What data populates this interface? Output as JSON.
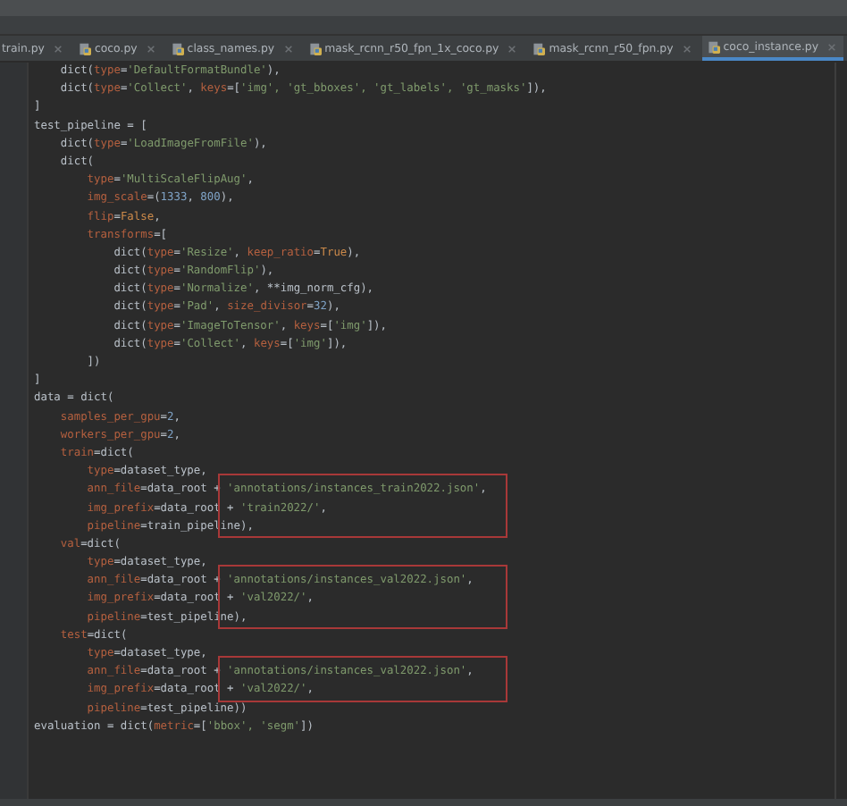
{
  "tabs": [
    {
      "label": "train.py",
      "icon": false,
      "selected": false
    },
    {
      "label": "coco.py",
      "icon": true,
      "selected": false
    },
    {
      "label": "class_names.py",
      "icon": true,
      "selected": false
    },
    {
      "label": "mask_rcnn_r50_fpn_1x_coco.py",
      "icon": true,
      "selected": false
    },
    {
      "label": "mask_rcnn_r50_fpn.py",
      "icon": true,
      "selected": false
    },
    {
      "label": "coco_instance.py",
      "icon": true,
      "selected": true
    }
  ],
  "code_lines": [
    {
      "boxed": false,
      "tokens": [
        {
          "kind": "plain",
          "text": "    dict("
        },
        {
          "kind": "param",
          "text": "type"
        },
        {
          "kind": "plain",
          "text": "="
        },
        {
          "kind": "string",
          "text": "'DefaultFormatBundle'"
        },
        {
          "kind": "plain",
          "text": "),"
        }
      ]
    },
    {
      "boxed": false,
      "tokens": [
        {
          "kind": "plain",
          "text": "    dict("
        },
        {
          "kind": "param",
          "text": "type"
        },
        {
          "kind": "plain",
          "text": "="
        },
        {
          "kind": "string",
          "text": "'Collect'"
        },
        {
          "kind": "plain",
          "text": ", "
        },
        {
          "kind": "param",
          "text": "keys"
        },
        {
          "kind": "plain",
          "text": "=["
        },
        {
          "kind": "string",
          "text": "'img', 'gt_bboxes', 'gt_labels', 'gt_masks'"
        },
        {
          "kind": "plain",
          "text": "]),"
        }
      ]
    },
    {
      "boxed": false,
      "tokens": [
        {
          "kind": "plain",
          "text": "]"
        }
      ]
    },
    {
      "boxed": false,
      "tokens": [
        {
          "kind": "plain",
          "text": "test_pipeline = ["
        }
      ]
    },
    {
      "boxed": false,
      "tokens": [
        {
          "kind": "plain",
          "text": "    dict("
        },
        {
          "kind": "param",
          "text": "type"
        },
        {
          "kind": "plain",
          "text": "="
        },
        {
          "kind": "string",
          "text": "'LoadImageFromFile'"
        },
        {
          "kind": "plain",
          "text": "),"
        }
      ]
    },
    {
      "boxed": false,
      "tokens": [
        {
          "kind": "plain",
          "text": "    dict("
        }
      ]
    },
    {
      "boxed": false,
      "tokens": [
        {
          "kind": "param",
          "text": "        type"
        },
        {
          "kind": "plain",
          "text": "="
        },
        {
          "kind": "string",
          "text": "'MultiScaleFlipAug'"
        },
        {
          "kind": "plain",
          "text": ","
        }
      ]
    },
    {
      "boxed": false,
      "tokens": [
        {
          "kind": "param",
          "text": "        img_scale"
        },
        {
          "kind": "plain",
          "text": "=("
        },
        {
          "kind": "number",
          "text": "1333"
        },
        {
          "kind": "plain",
          "text": ", "
        },
        {
          "kind": "number",
          "text": "800"
        },
        {
          "kind": "plain",
          "text": "),"
        }
      ]
    },
    {
      "boxed": false,
      "tokens": [
        {
          "kind": "param",
          "text": "        flip"
        },
        {
          "kind": "plain",
          "text": "="
        },
        {
          "kind": "keyword",
          "text": "False"
        },
        {
          "kind": "plain",
          "text": ","
        }
      ]
    },
    {
      "boxed": false,
      "tokens": [
        {
          "kind": "param",
          "text": "        transforms"
        },
        {
          "kind": "plain",
          "text": "=["
        }
      ]
    },
    {
      "boxed": false,
      "tokens": [
        {
          "kind": "plain",
          "text": "            dict("
        },
        {
          "kind": "param",
          "text": "type"
        },
        {
          "kind": "plain",
          "text": "="
        },
        {
          "kind": "string",
          "text": "'Resize'"
        },
        {
          "kind": "plain",
          "text": ", "
        },
        {
          "kind": "param",
          "text": "keep_ratio"
        },
        {
          "kind": "plain",
          "text": "="
        },
        {
          "kind": "keyword",
          "text": "True"
        },
        {
          "kind": "plain",
          "text": "),"
        }
      ]
    },
    {
      "boxed": false,
      "tokens": [
        {
          "kind": "plain",
          "text": "            dict("
        },
        {
          "kind": "param",
          "text": "type"
        },
        {
          "kind": "plain",
          "text": "="
        },
        {
          "kind": "string",
          "text": "'RandomFlip'"
        },
        {
          "kind": "plain",
          "text": "),"
        }
      ]
    },
    {
      "boxed": false,
      "tokens": [
        {
          "kind": "plain",
          "text": "            dict("
        },
        {
          "kind": "param",
          "text": "type"
        },
        {
          "kind": "plain",
          "text": "="
        },
        {
          "kind": "string",
          "text": "'Normalize'"
        },
        {
          "kind": "plain",
          "text": ", **img_norm_cfg),"
        }
      ]
    },
    {
      "boxed": false,
      "tokens": [
        {
          "kind": "plain",
          "text": "            dict("
        },
        {
          "kind": "param",
          "text": "type"
        },
        {
          "kind": "plain",
          "text": "="
        },
        {
          "kind": "string",
          "text": "'Pad'"
        },
        {
          "kind": "plain",
          "text": ", "
        },
        {
          "kind": "param",
          "text": "size_divisor"
        },
        {
          "kind": "plain",
          "text": "="
        },
        {
          "kind": "number",
          "text": "32"
        },
        {
          "kind": "plain",
          "text": "),"
        }
      ]
    },
    {
      "boxed": false,
      "tokens": [
        {
          "kind": "plain",
          "text": "            dict("
        },
        {
          "kind": "param",
          "text": "type"
        },
        {
          "kind": "plain",
          "text": "="
        },
        {
          "kind": "string",
          "text": "'ImageToTensor'"
        },
        {
          "kind": "plain",
          "text": ", "
        },
        {
          "kind": "param",
          "text": "keys"
        },
        {
          "kind": "plain",
          "text": "=["
        },
        {
          "kind": "string",
          "text": "'img'"
        },
        {
          "kind": "plain",
          "text": "]),"
        }
      ]
    },
    {
      "boxed": false,
      "tokens": [
        {
          "kind": "plain",
          "text": "            dict("
        },
        {
          "kind": "param",
          "text": "type"
        },
        {
          "kind": "plain",
          "text": "="
        },
        {
          "kind": "string",
          "text": "'Collect'"
        },
        {
          "kind": "plain",
          "text": ", "
        },
        {
          "kind": "param",
          "text": "keys"
        },
        {
          "kind": "plain",
          "text": "=["
        },
        {
          "kind": "string",
          "text": "'img'"
        },
        {
          "kind": "plain",
          "text": "]),"
        }
      ]
    },
    {
      "boxed": false,
      "tokens": [
        {
          "kind": "plain",
          "text": "        ])"
        }
      ]
    },
    {
      "boxed": false,
      "tokens": [
        {
          "kind": "plain",
          "text": "]"
        }
      ]
    },
    {
      "boxed": false,
      "tokens": [
        {
          "kind": "plain",
          "text": "data = dict("
        }
      ]
    },
    {
      "boxed": false,
      "tokens": [
        {
          "kind": "param",
          "text": "    samples_per_gpu"
        },
        {
          "kind": "plain",
          "text": "="
        },
        {
          "kind": "number",
          "text": "2"
        },
        {
          "kind": "plain",
          "text": ","
        }
      ]
    },
    {
      "boxed": false,
      "tokens": [
        {
          "kind": "param",
          "text": "    workers_per_gpu"
        },
        {
          "kind": "plain",
          "text": "="
        },
        {
          "kind": "number",
          "text": "2"
        },
        {
          "kind": "plain",
          "text": ","
        }
      ]
    },
    {
      "boxed": false,
      "tokens": [
        {
          "kind": "param",
          "text": "    train"
        },
        {
          "kind": "plain",
          "text": "=dict("
        }
      ]
    },
    {
      "boxed": false,
      "tokens": [
        {
          "kind": "param",
          "text": "        type"
        },
        {
          "kind": "plain",
          "text": "=dataset_type,"
        }
      ]
    },
    {
      "boxed": true,
      "tokens": [
        {
          "kind": "param",
          "text": "        ann_file"
        },
        {
          "kind": "plain",
          "text": "=data_root + "
        },
        {
          "kind": "string",
          "text": "'annotations/instances_train2022.json'"
        },
        {
          "kind": "plain",
          "text": ","
        }
      ]
    },
    {
      "boxed": true,
      "tokens": [
        {
          "kind": "param",
          "text": "        img_prefix"
        },
        {
          "kind": "plain",
          "text": "=data_root + "
        },
        {
          "kind": "string",
          "text": "'train2022/'"
        },
        {
          "kind": "plain",
          "text": ","
        }
      ]
    },
    {
      "boxed": true,
      "tokens": [
        {
          "kind": "param",
          "text": "        pipeline"
        },
        {
          "kind": "plain",
          "text": "=train_pipeline),"
        }
      ]
    },
    {
      "boxed": false,
      "tokens": [
        {
          "kind": "param",
          "text": "    val"
        },
        {
          "kind": "plain",
          "text": "=dict("
        }
      ]
    },
    {
      "boxed": false,
      "tokens": [
        {
          "kind": "param",
          "text": "        type"
        },
        {
          "kind": "plain",
          "text": "=dataset_type,"
        }
      ]
    },
    {
      "boxed": true,
      "tokens": [
        {
          "kind": "param",
          "text": "        ann_file"
        },
        {
          "kind": "plain",
          "text": "=data_root + "
        },
        {
          "kind": "string",
          "text": "'annotations/instances_val2022.json'"
        },
        {
          "kind": "plain",
          "text": ","
        }
      ]
    },
    {
      "boxed": true,
      "tokens": [
        {
          "kind": "param",
          "text": "        img_prefix"
        },
        {
          "kind": "plain",
          "text": "=data_root + "
        },
        {
          "kind": "string",
          "text": "'val2022/'"
        },
        {
          "kind": "plain",
          "text": ","
        }
      ]
    },
    {
      "boxed": true,
      "tokens": [
        {
          "kind": "param",
          "text": "        pipeline"
        },
        {
          "kind": "plain",
          "text": "=test_pipeline),"
        }
      ]
    },
    {
      "boxed": false,
      "tokens": [
        {
          "kind": "param",
          "text": "    test"
        },
        {
          "kind": "plain",
          "text": "=dict("
        }
      ]
    },
    {
      "boxed": false,
      "tokens": [
        {
          "kind": "param",
          "text": "        type"
        },
        {
          "kind": "plain",
          "text": "=dataset_type,"
        }
      ]
    },
    {
      "boxed": true,
      "tokens": [
        {
          "kind": "param",
          "text": "        ann_file"
        },
        {
          "kind": "plain",
          "text": "=data_root + "
        },
        {
          "kind": "string",
          "text": "'annotations/instances_val2022.json'"
        },
        {
          "kind": "plain",
          "text": ","
        }
      ]
    },
    {
      "boxed": true,
      "tokens": [
        {
          "kind": "param",
          "text": "        img_prefix"
        },
        {
          "kind": "plain",
          "text": "=data_root + "
        },
        {
          "kind": "string",
          "text": "'val2022/'"
        },
        {
          "kind": "plain",
          "text": ","
        }
      ]
    },
    {
      "boxed": false,
      "tokens": [
        {
          "kind": "param",
          "text": "        pipeline"
        },
        {
          "kind": "plain",
          "text": "=test_pipeline))"
        }
      ]
    },
    {
      "boxed": false,
      "tokens": [
        {
          "kind": "plain",
          "text": "evaluation = dict("
        },
        {
          "kind": "param",
          "text": "metric"
        },
        {
          "kind": "plain",
          "text": "=["
        },
        {
          "kind": "string",
          "text": "'bbox', 'segm'"
        },
        {
          "kind": "plain",
          "text": "])"
        }
      ]
    }
  ]
}
